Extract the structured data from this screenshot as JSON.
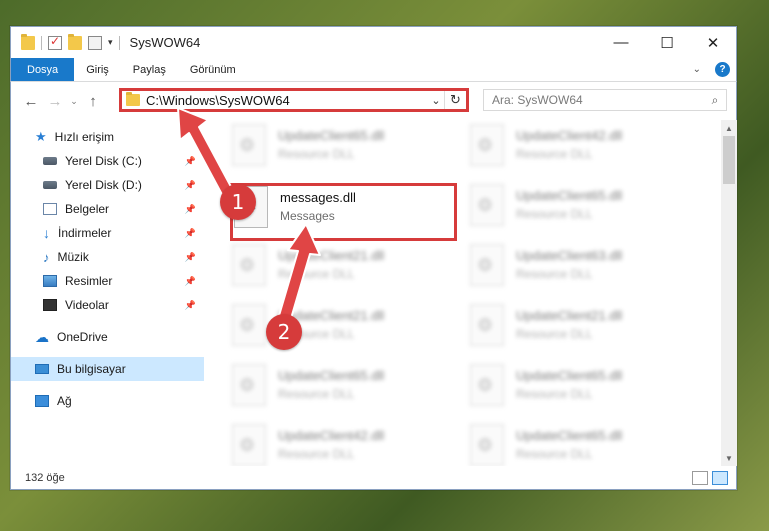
{
  "window": {
    "title": "SysWOW64",
    "controls": {
      "minimize": "—",
      "maximize": "☐",
      "close": "✕"
    }
  },
  "ribbon": {
    "tabs": [
      "Dosya",
      "Giriş",
      "Paylaş",
      "Görünüm"
    ],
    "accent": "#1979ca"
  },
  "nav": {
    "back": "←",
    "forward": "→",
    "recent": "⌄",
    "up": "↑",
    "address": "C:\\Windows\\SysWOW64",
    "search_placeholder": "Ara: SysWOW64"
  },
  "sidebar": {
    "items": [
      {
        "label": "Hızlı erişim",
        "icon": "star-icon"
      },
      {
        "label": "Yerel Disk (C:)",
        "icon": "disk-icon"
      },
      {
        "label": "Yerel Disk (D:)",
        "icon": "disk-icon"
      },
      {
        "label": "Belgeler",
        "icon": "document-icon"
      },
      {
        "label": "İndirmeler",
        "icon": "download-icon"
      },
      {
        "label": "Müzik",
        "icon": "music-icon"
      },
      {
        "label": "Resimler",
        "icon": "pictures-icon"
      },
      {
        "label": "Videolar",
        "icon": "videos-icon"
      },
      {
        "label": "OneDrive",
        "icon": "cloud-icon"
      },
      {
        "label": "Bu bilgisayar",
        "icon": "computer-icon"
      },
      {
        "label": "Ağ",
        "icon": "network-icon"
      }
    ]
  },
  "files": {
    "col1": [
      {
        "name": "UpdateClient65.dll",
        "type": "Resource DLL"
      },
      {
        "name": "messages.dll",
        "type": "Messages"
      },
      {
        "name": "UpdateClient21.dll",
        "type": "Resource DLL"
      },
      {
        "name": "UpdateClient21.dll",
        "type": "Resource DLL"
      },
      {
        "name": "UpdateClient65.dll",
        "type": "Resource DLL"
      },
      {
        "name": "UpdateClient42.dll",
        "type": "Resource DLL"
      }
    ],
    "col2": [
      {
        "name": "UpdateClient42.dll",
        "type": "Resource DLL"
      },
      {
        "name": "UpdateClient65.dll",
        "type": "Resource DLL"
      },
      {
        "name": "UpdateClient63.dll",
        "type": "Resource DLL"
      },
      {
        "name": "UpdateClient21.dll",
        "type": "Resource DLL"
      },
      {
        "name": "UpdateClient65.dll",
        "type": "Resource DLL"
      },
      {
        "name": "UpdateClient65.dll",
        "type": "Resource DLL"
      }
    ]
  },
  "status": {
    "count": "132 öğe"
  },
  "callouts": {
    "one": "1",
    "two": "2"
  },
  "colors": {
    "highlight": "#d63b3b",
    "selection": "#cce8ff"
  }
}
